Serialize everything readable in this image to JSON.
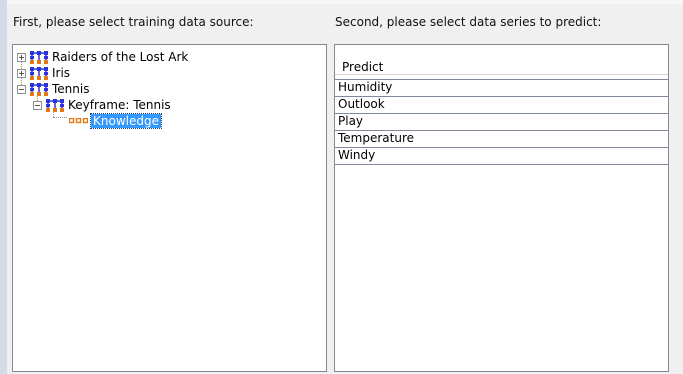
{
  "left_section": {
    "label": "First, please select training data source:",
    "tree": [
      {
        "label": "Raiders of the Lost Ark",
        "type": "datasource",
        "expanded": false
      },
      {
        "label": "Iris",
        "type": "datasource",
        "expanded": false
      },
      {
        "label": "Tennis",
        "type": "datasource",
        "expanded": true
      },
      {
        "label": "Keyframe: Tennis",
        "type": "keyframe",
        "expanded": true
      },
      {
        "label": "Knowledge",
        "type": "knowledge",
        "selected": true
      }
    ]
  },
  "right_section": {
    "label": "Second, please select data series to predict:",
    "column_header": "Predict",
    "rows": [
      "Humidity",
      "Outlook",
      "Play",
      "Temperature",
      "Windy"
    ]
  },
  "colors": {
    "selection": "#3399ff",
    "icon_blue": "#2a34d8",
    "icon_orange": "#e07a10",
    "panel_border": "#828790"
  },
  "icons": {
    "collapsed": "plus-box-icon",
    "expanded": "minus-box-icon",
    "datasource": "dataset-network-icon",
    "knowledge": "knowledge-nodes-icon"
  }
}
